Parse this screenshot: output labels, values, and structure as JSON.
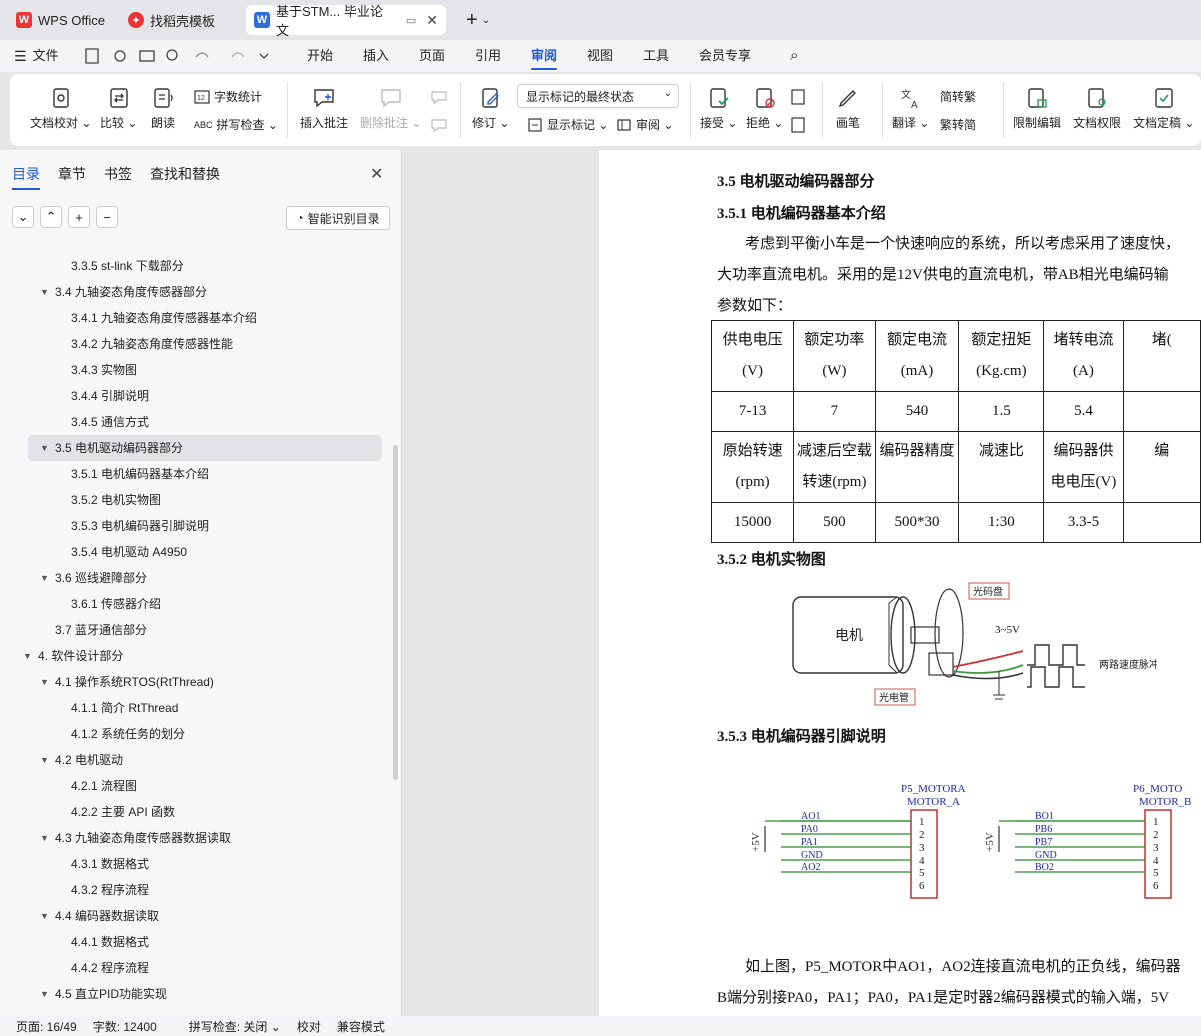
{
  "tabs": [
    {
      "label": "WPS Office",
      "icon": "wps-logo-icon"
    },
    {
      "label": "找稻壳模板",
      "icon": "docer-icon"
    },
    {
      "label": "基于STM... 毕业论文",
      "icon": "word-doc-icon"
    }
  ],
  "menu": {
    "file": "文件",
    "items": [
      "开始",
      "插入",
      "页面",
      "引用",
      "审阅",
      "视图",
      "工具",
      "会员专享"
    ],
    "active": "审阅"
  },
  "ribbon": {
    "doc_check": "文档校对",
    "compare": "比较",
    "read_aloud": "朗读",
    "word_count": "字数统计",
    "spell_check": "拼写检查",
    "insert_comment": "插入批注",
    "delete_comment": "删除批注",
    "revise": "修订",
    "markup_state": "显示标记的最终状态",
    "show_markup": "显示标记",
    "review": "审阅",
    "accept": "接受",
    "reject": "拒绝",
    "pen": "画笔",
    "translate": "翻译",
    "to_traditional": "简转繁",
    "to_simplified": "繁转简",
    "restrict_edit": "限制编辑",
    "doc_permission": "文档权限",
    "doc_finalize": "文档定稿"
  },
  "sidebar": {
    "tabs": [
      "目录",
      "章节",
      "书签",
      "查找和替换"
    ],
    "smart_toc": "智能识别目录",
    "toc": [
      {
        "text": "3.3.5 st-link 下载部分",
        "level": 3,
        "arrow": false
      },
      {
        "text": "3.4 九轴姿态角度传感器部分",
        "level": 2,
        "arrow": true
      },
      {
        "text": "3.4.1 九轴姿态角度传感器基本介绍",
        "level": 3,
        "arrow": false
      },
      {
        "text": "3.4.2 九轴姿态角度传感器性能",
        "level": 3,
        "arrow": false
      },
      {
        "text": "3.4.3 实物图",
        "level": 3,
        "arrow": false
      },
      {
        "text": "3.4.4 引脚说明",
        "level": 3,
        "arrow": false
      },
      {
        "text": "3.4.5 通信方式",
        "level": 3,
        "arrow": false
      },
      {
        "text": "3.5 电机驱动编码器部分",
        "level": 2,
        "arrow": true,
        "selected": true
      },
      {
        "text": "3.5.1 电机编码器基本介绍",
        "level": 3,
        "arrow": false
      },
      {
        "text": "3.5.2 电机实物图",
        "level": 3,
        "arrow": false
      },
      {
        "text": "3.5.3 电机编码器引脚说明",
        "level": 3,
        "arrow": false
      },
      {
        "text": "3.5.4 电机驱动 A4950",
        "level": 3,
        "arrow": false
      },
      {
        "text": "3.6 巡线避障部分",
        "level": 2,
        "arrow": true
      },
      {
        "text": "3.6.1 传感器介绍",
        "level": 3,
        "arrow": false
      },
      {
        "text": "3.7 蓝牙通信部分",
        "level": 2,
        "arrow": false
      },
      {
        "text": "4. 软件设计部分",
        "level": 1,
        "arrow": true
      },
      {
        "text": "4.1 操作系统RTOS(RtThread)",
        "level": 2,
        "arrow": true
      },
      {
        "text": "4.1.1 简介 RtThread",
        "level": 3,
        "arrow": false
      },
      {
        "text": "4.1.2 系统任务的划分",
        "level": 3,
        "arrow": false
      },
      {
        "text": "4.2 电机驱动",
        "level": 2,
        "arrow": true
      },
      {
        "text": "4.2.1 流程图",
        "level": 3,
        "arrow": false
      },
      {
        "text": "4.2.2 主要 API 函数",
        "level": 3,
        "arrow": false
      },
      {
        "text": "4.3 九轴姿态角度传感器数据读取",
        "level": 2,
        "arrow": true
      },
      {
        "text": "4.3.1 数据格式",
        "level": 3,
        "arrow": false
      },
      {
        "text": "4.3.2 程序流程",
        "level": 3,
        "arrow": false
      },
      {
        "text": "4.4 编码器数据读取",
        "level": 2,
        "arrow": true
      },
      {
        "text": "4.4.1 数据格式",
        "level": 3,
        "arrow": false
      },
      {
        "text": "4.4.2 程序流程",
        "level": 3,
        "arrow": false
      },
      {
        "text": "4.5 直立PID功能实现",
        "level": 2,
        "arrow": true
      }
    ]
  },
  "document": {
    "h_35": "3.5 电机驱动编码器部分",
    "h_351": "3.5.1 电机编码器基本介绍",
    "para1_l1": "考虑到平衡小车是一个快速响应的系统，所以考虑采用了速度快，",
    "para1_l2": "大功率直流电机。采用的是12V供电的直流电机，带AB相光电编码输",
    "para1_l3": "参数如下：",
    "table": [
      [
        "供电电压(V)",
        "额定功率(W)",
        "额定电流(mA)",
        "额定扭矩(Kg.cm)",
        "堵转电流(A)",
        "堵("
      ],
      [
        "7-13",
        "7",
        "540",
        "1.5",
        "5.4",
        ""
      ],
      [
        "原始转速(rpm)",
        "减速后空载转速(rpm)",
        "编码器精度",
        "减速比",
        "编码器供电电压(V)",
        "编"
      ],
      [
        "15000",
        "500",
        "500*30",
        "1:30",
        "3.3-5",
        ""
      ]
    ],
    "h_352": "3.5.2 电机实物图",
    "motor_fig": {
      "motor": "电机",
      "disc": "光码盘",
      "voltage": "3~5V",
      "signal": "两路速度脉冲信号",
      "tube": "光电管"
    },
    "h_353": "3.5.3 电机编码器引脚说明",
    "schem": {
      "a_title1": "P5_MOTORA",
      "a_title2": "MOTOR_A",
      "a_pins": [
        "AO1",
        "PA0",
        "PA1",
        "GND",
        "AO2"
      ],
      "b_title1": "P6_MOTO",
      "b_title2": "MOTOR_B",
      "b_pins": [
        "BO1",
        "PB6",
        "PB7",
        "GND",
        "BO2"
      ],
      "pin_nums": [
        "1",
        "2",
        "3",
        "4",
        "5",
        "6"
      ],
      "vlabel": "+5V"
    },
    "para2_l1": "如上图，P5_MOTOR中AO1，AO2连接直流电机的正负线，编码器",
    "para2_l2": "B端分别接PA0，PA1；PA0，PA1是定时器2编码器模式的输入端，5V"
  },
  "status": {
    "page": "页面: 16/49",
    "words": "字数: 12400",
    "spell": "拼写检查: 关闭",
    "proof": "校对",
    "compat": "兼容模式"
  }
}
